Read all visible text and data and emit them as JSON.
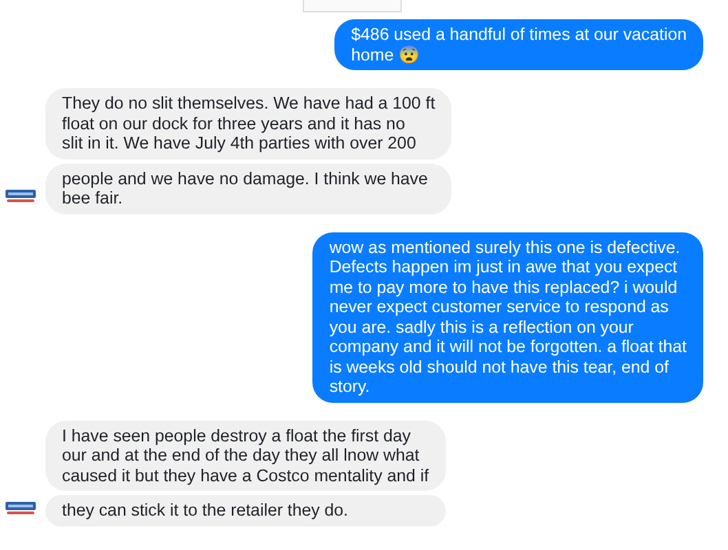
{
  "messages": [
    {
      "kind": "sent",
      "bubbles": [
        {
          "lines": [
            "$486 used a handful of times at our vacation",
            "home 😨"
          ]
        }
      ]
    },
    {
      "kind": "received",
      "bubbles": [
        {
          "lines": [
            "They do no slit themselves. We have had a 100 ft",
            "float on our dock for three years and it has no",
            "slit in it. We have July 4th parties with over 200"
          ]
        },
        {
          "lines": [
            "people and we have no damage. I think we have",
            "bee fair."
          ]
        }
      ]
    },
    {
      "kind": "sent",
      "bubbles": [
        {
          "lines": [
            "wow as mentioned surely this one is defective.",
            "Defects happen im just in awe that you expect",
            "me to pay more to have this replaced? i would",
            "never expect customer service to respond as",
            "you are. sadly this is a reflection on your",
            "company and it will not be forgotten. a float that",
            "is weeks old should not have this tear, end of",
            "story."
          ]
        }
      ]
    },
    {
      "kind": "received",
      "bubbles": [
        {
          "lines": [
            "I have seen people destroy a float the first day",
            "our and at the end of the day they all lnow what",
            "caused it but they have a Costco mentality and if"
          ]
        },
        {
          "lines": [
            "they can stick it to the retailer they do."
          ]
        }
      ]
    }
  ]
}
